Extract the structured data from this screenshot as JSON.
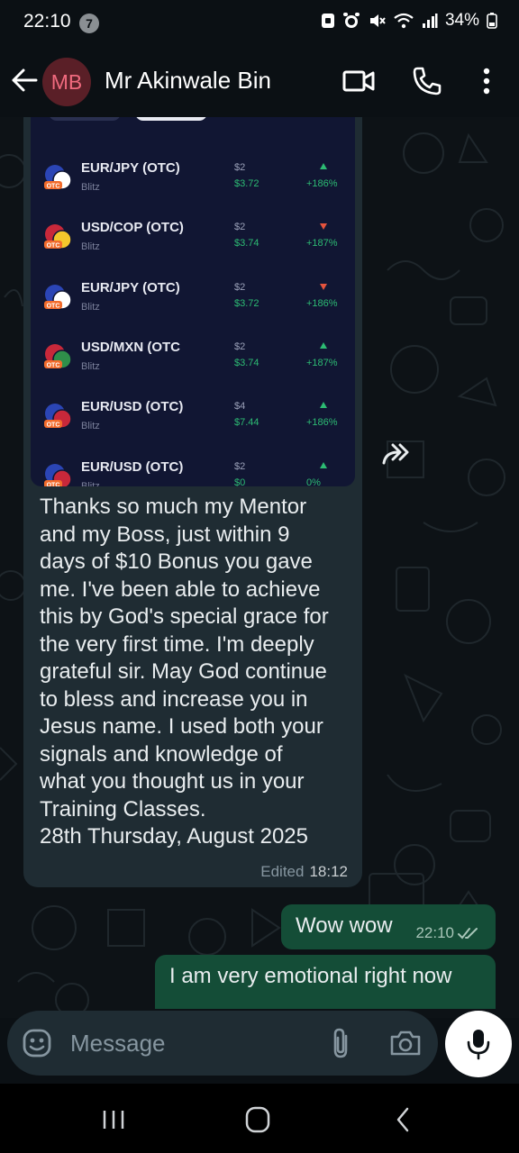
{
  "status_bar": {
    "time": "22:10",
    "notification_count": "7",
    "battery": "34%"
  },
  "header": {
    "avatar_initials": "MB",
    "contact_name": "Mr Akinwale Bin"
  },
  "trade_screenshot": {
    "rows": [
      {
        "pair": "EUR/JPY (OTC)",
        "sub": "Blitz",
        "amount": "$2",
        "payout": "$3.72",
        "direction": "up",
        "percent": "+186%",
        "flag": "eu-jp"
      },
      {
        "pair": "USD/COP (OTC)",
        "sub": "Blitz",
        "amount": "$2",
        "payout": "$3.74",
        "direction": "down",
        "percent": "+187%",
        "flag": "us-co"
      },
      {
        "pair": "EUR/JPY (OTC)",
        "sub": "Blitz",
        "amount": "$2",
        "payout": "$3.72",
        "direction": "down",
        "percent": "+186%",
        "flag": "eu-jp"
      },
      {
        "pair": "USD/MXN (OTC",
        "sub": "Blitz",
        "amount": "$2",
        "payout": "$3.74",
        "direction": "up",
        "percent": "+187%",
        "flag": "us-mx"
      },
      {
        "pair": "EUR/USD (OTC)",
        "sub": "Blitz",
        "amount": "$4",
        "payout": "$7.44",
        "direction": "up",
        "percent": "+186%",
        "flag": "eu-us"
      },
      {
        "pair": "EUR/USD (OTC)",
        "sub": "Blitz",
        "amount": "$2",
        "payout": "$0",
        "direction": "up",
        "percent": "0%",
        "flag": "eu-us"
      }
    ],
    "otc_badge": "OTC"
  },
  "received_message": {
    "lines": [
      "Thanks so much my Mentor",
      "and my Boss, just within 9",
      "days of $10 Bonus you gave",
      "me. I've been able to achieve",
      "this by God's special grace for",
      "the very first time.  I'm deeply",
      "grateful sir. May God continue",
      "to bless and increase you in",
      "Jesus name. I used both your",
      "signals and knowledge of",
      "what you thought us in your",
      "Training Classes.",
      "28th Thursday, August 2025"
    ],
    "edited_label": "Edited",
    "time": "18:12"
  },
  "sent_messages": [
    {
      "text": "Wow wow",
      "time": "22:10"
    },
    {
      "text": "I am very emotional  right now",
      "time": ""
    }
  ],
  "composer": {
    "placeholder": "Message"
  },
  "colors": {
    "sent_bubble": "#144d37",
    "received_bubble": "#1f2c33",
    "gain_green": "#2dbb73",
    "loss_red": "#e5533d",
    "avatar_text": "#f06a7e"
  },
  "icons": [
    "back-arrow-icon",
    "video-call-icon",
    "voice-call-icon",
    "more-options-icon",
    "forward-icon",
    "emoji-icon",
    "attach-icon",
    "camera-icon",
    "mic-icon",
    "double-check-icon"
  ]
}
